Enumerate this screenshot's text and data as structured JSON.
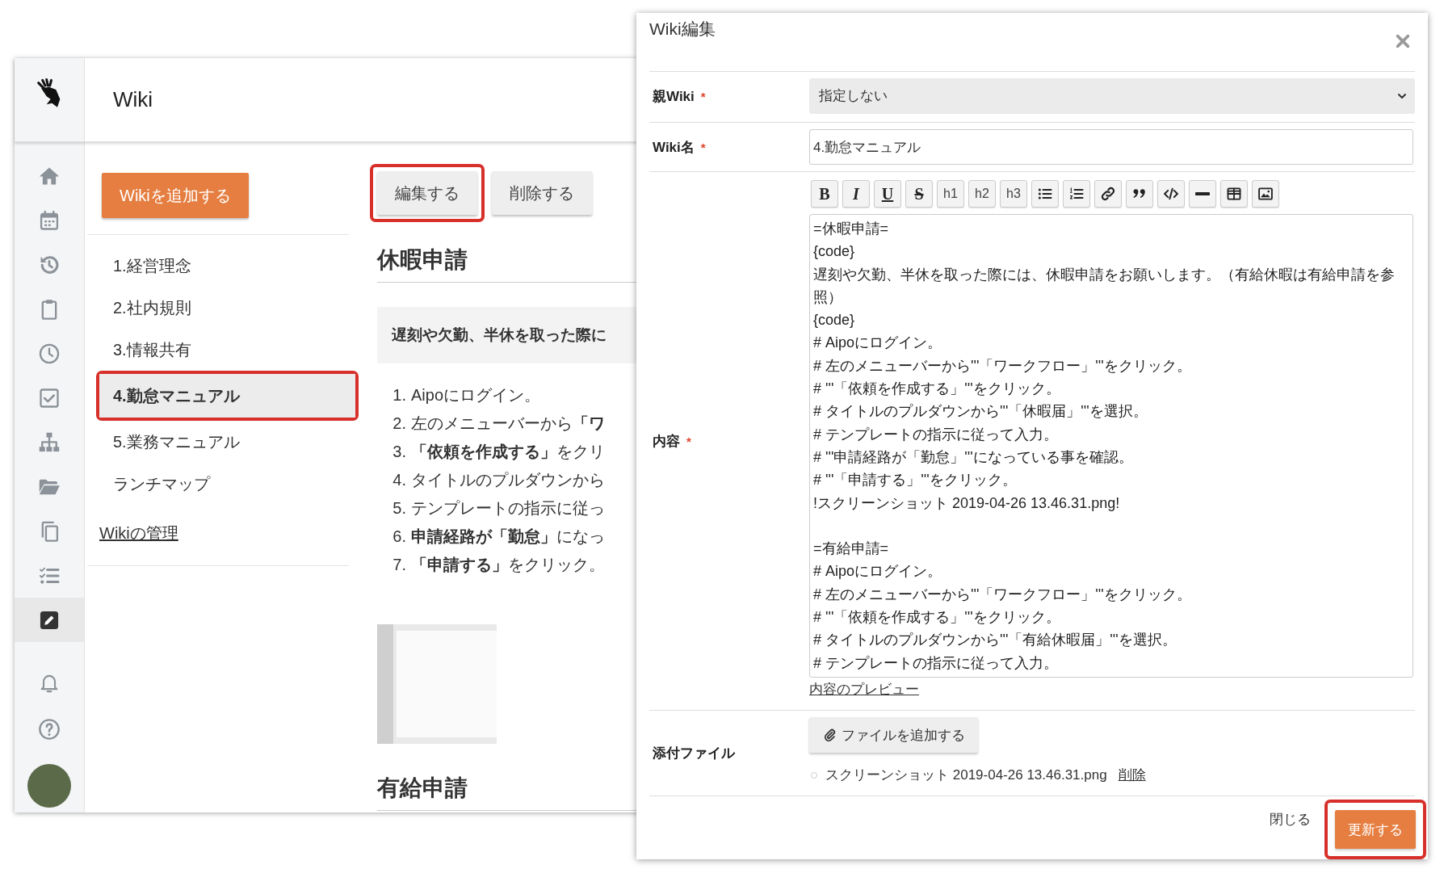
{
  "sidebar": {
    "items": [
      {
        "kind": "home",
        "selected": false
      },
      {
        "kind": "calendar",
        "selected": false
      },
      {
        "kind": "history",
        "selected": false
      },
      {
        "kind": "clipboard",
        "selected": false
      },
      {
        "kind": "clock",
        "selected": false
      },
      {
        "kind": "checkbox",
        "selected": false
      },
      {
        "kind": "sitemap",
        "selected": false
      },
      {
        "kind": "folder",
        "selected": false
      },
      {
        "kind": "copy",
        "selected": false
      },
      {
        "kind": "checklist",
        "selected": false
      },
      {
        "kind": "edit",
        "selected": true
      },
      {
        "kind": "bell",
        "selected": false
      },
      {
        "kind": "help",
        "selected": false
      }
    ]
  },
  "header": {
    "title": "Wiki"
  },
  "wiki_list": {
    "add_button": "Wikiを追加する",
    "items": [
      {
        "label": "1.経営理念",
        "selected": false,
        "highlighted": false
      },
      {
        "label": "2.社内規則",
        "selected": false,
        "highlighted": false
      },
      {
        "label": "3.情報共有",
        "selected": false,
        "highlighted": false
      },
      {
        "label": "4.勤怠マニュアル",
        "selected": true,
        "highlighted": true
      },
      {
        "label": "5.業務マニュアル",
        "selected": false,
        "highlighted": false
      },
      {
        "label": "ランチマップ",
        "selected": false,
        "highlighted": false
      }
    ],
    "manage_link": "Wikiの管理"
  },
  "page": {
    "actions": [
      {
        "label": "編集する",
        "highlighted": true
      },
      {
        "label": "削除する",
        "highlighted": false
      }
    ],
    "heading": "休暇申請",
    "quote": "遅刻や欠勤、半休を取った際に",
    "steps": [
      {
        "number": "1.",
        "text": "Aipoにログイン。"
      },
      {
        "number": "2.",
        "text": "左のメニューバーから**「ワ**"
      },
      {
        "number": "3.",
        "text": "**「依頼を作成する」**をクリ"
      },
      {
        "number": "4.",
        "text": "タイトルのプルダウンから"
      },
      {
        "number": "5.",
        "text": "テンプレートの指示に従っ"
      },
      {
        "number": "6.",
        "text": "**申請経路が「勤怠」**になっ"
      },
      {
        "number": "7.",
        "text": "**「申請する」**をクリック。"
      }
    ],
    "next_heading": "有給申請"
  },
  "dialog": {
    "title": "Wiki編集",
    "fields": [
      {
        "kind": "select",
        "label": "親Wiki",
        "mark": "*",
        "value": "指定しない"
      },
      {
        "kind": "text",
        "label": "Wiki名",
        "mark": "*",
        "value": "4.勤怠マニュアル"
      },
      {
        "kind": "editor",
        "label": "内容",
        "mark": "*",
        "toolbar": [
          {
            "kind": "bold",
            "label": "B"
          },
          {
            "kind": "italic",
            "label": "I"
          },
          {
            "kind": "underline",
            "label": "U"
          },
          {
            "kind": "strike",
            "label": "S"
          },
          {
            "kind": "heading",
            "label": "h1"
          },
          {
            "kind": "heading",
            "label": "h2"
          },
          {
            "kind": "heading",
            "label": "h3"
          },
          {
            "kind": "bullets"
          },
          {
            "kind": "numbers"
          },
          {
            "kind": "link"
          },
          {
            "kind": "quote"
          },
          {
            "kind": "code"
          },
          {
            "kind": "rule"
          },
          {
            "kind": "table"
          },
          {
            "kind": "image"
          }
        ],
        "value": "=休暇申請=\n{code}\n遅刻や欠勤、半休を取った際には、休暇申請をお願いします。（有給休暇は有給申請を参照）\n{code}\n# Aipoにログイン。\n# 左のメニューバーから'''「ワークフロー」'''をクリック。\n# '''「依頼を作成する」'''をクリック。\n# タイトルのプルダウンから'''「休暇届」'''を選択。\n# テンプレートの指示に従って入力。\n# '''申請経路が「勤怠」'''になっている事を確認。\n# '''「申請する」'''をクリック。\n!スクリーンショット 2019-04-26 13.46.31.png!\n\n=有給申請=\n# Aipoにログイン。\n# 左のメニューバーから'''「ワークフロー」'''をクリック。\n# '''「依頼を作成する」'''をクリック。\n# タイトルのプルダウンから'''「有給休暇届」'''を選択。\n# テンプレートの指示に従って入力。",
        "preview_link": "内容のプレビュー"
      },
      {
        "kind": "attachments",
        "label": "添付ファイル",
        "button": "ファイルを追加する",
        "files": [
          {
            "name": "スクリーンショット 2019-04-26 13.46.31.png",
            "delete_link": "削除"
          }
        ]
      }
    ],
    "footer": [
      {
        "kind": "link",
        "label": "閉じる",
        "highlighted": false
      },
      {
        "kind": "primary",
        "label": "更新する",
        "highlighted": true
      }
    ]
  }
}
